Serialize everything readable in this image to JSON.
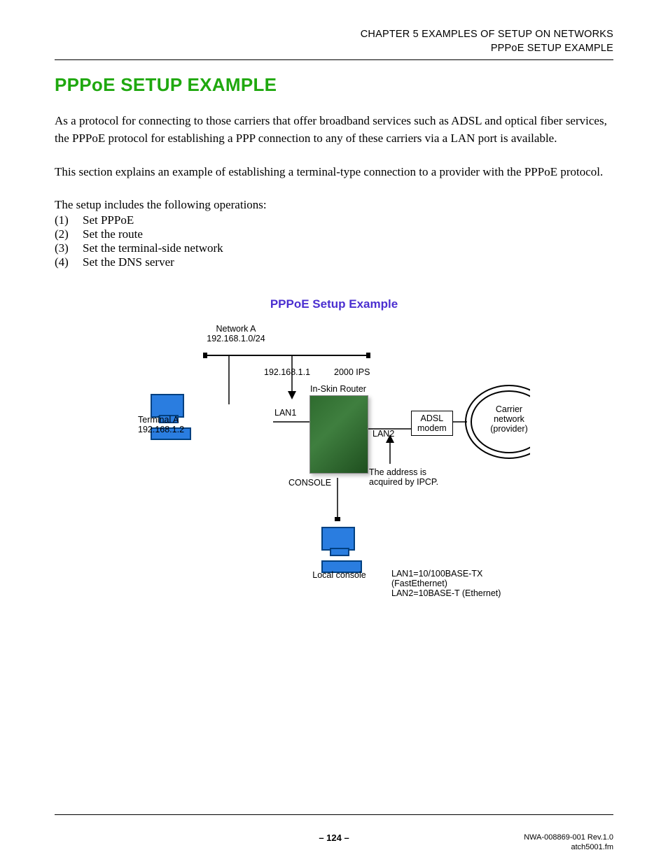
{
  "header": {
    "chapter": "CHAPTER 5   EXAMPLES OF SETUP ON NETWORKS",
    "section": "PPPoE SETUP EXAMPLE"
  },
  "title": "PPPoE SETUP EXAMPLE",
  "para1": "As a protocol for connecting to those carriers that offer broadband services such as ADSL and optical fiber services, the PPPoE protocol for establishing a PPP connection to any of these carriers via a LAN port is available.",
  "para2": "This section explains an example of establishing a terminal-type connection to a provider with the PPPoE protocol.",
  "ops_intro": "The setup includes the following operations:",
  "ops": [
    {
      "n": "(1)",
      "t": "Set PPPoE"
    },
    {
      "n": "(2)",
      "t": "Set the route"
    },
    {
      "n": "(3)",
      "t": "Set the terminal-side network"
    },
    {
      "n": "(4)",
      "t": "Set the DNS server"
    }
  ],
  "figure_title": "PPPoE Setup Example",
  "diagram": {
    "network_a": "Network A",
    "network_a_cidr": "192.168.1.0/24",
    "router_ip": "192.168.1.1",
    "ips": "2000 IPS",
    "in_skin": "In-Skin Router",
    "lan1": "LAN1",
    "lan2": "LAN2",
    "terminal_a": "Terminal A",
    "terminal_a_ip": "192.168.1.2",
    "console": "CONSOLE",
    "ipcp1": "The address is",
    "ipcp2": "acquired by IPCP.",
    "adsl1": "ADSL",
    "adsl2": "modem",
    "cloud1": "Carrier",
    "cloud2": "network",
    "cloud3": "(provider)",
    "local_console": "Local console",
    "legend1": "LAN1=10/100BASE-TX (FastEthernet)",
    "legend2": "LAN2=10BASE-T (Ethernet)"
  },
  "footer": {
    "page": "– 124 –",
    "doc": "NWA-008869-001 Rev.1.0",
    "file": "atch5001.fm"
  }
}
